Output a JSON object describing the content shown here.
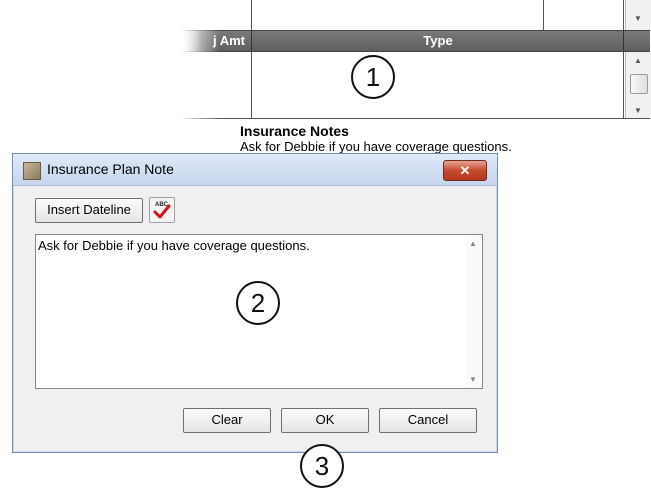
{
  "grid": {
    "column_adj_amt": "j Amt",
    "column_type": "Type"
  },
  "notes": {
    "title": "Insurance Notes",
    "body": "Ask for Debbie if you have coverage questions."
  },
  "callouts": [
    "1",
    "2",
    "3"
  ],
  "dialog": {
    "title": "Insurance Plan Note",
    "close_label": "✕",
    "insert_dateline_label": "Insert Dateline",
    "spellcheck_icon": "spellcheck-icon",
    "note_text": "Ask for Debbie if you have coverage questions.",
    "clear_label": "Clear",
    "ok_label": "OK",
    "cancel_label": "Cancel"
  }
}
